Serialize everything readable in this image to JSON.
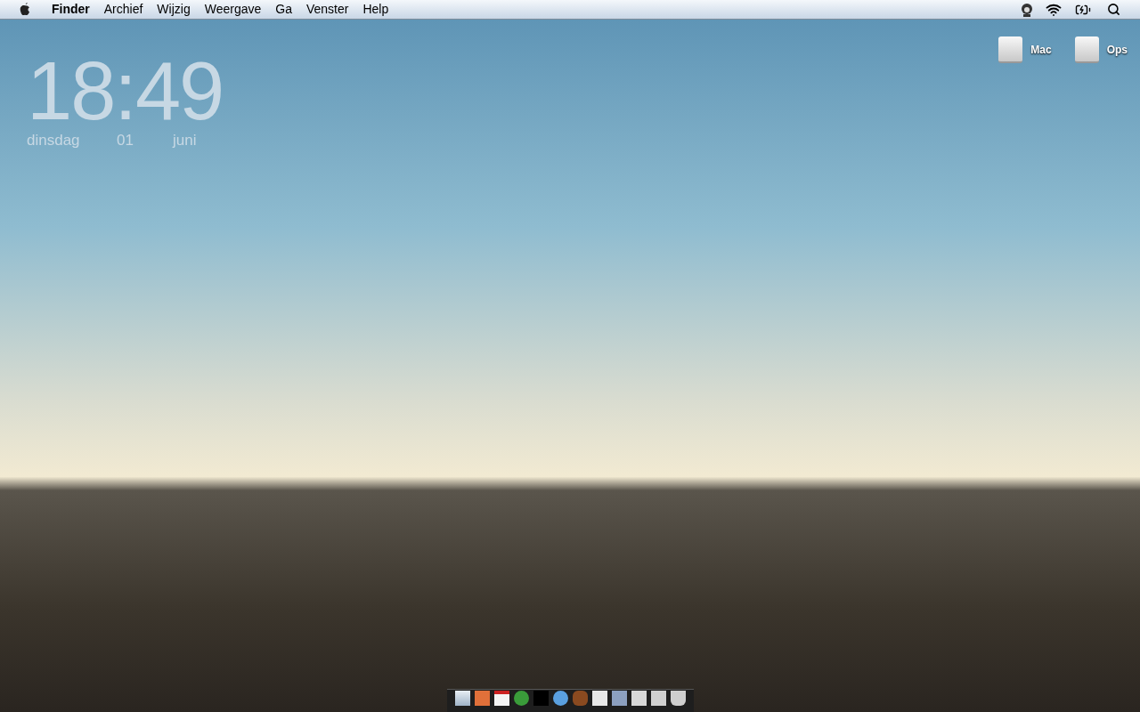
{
  "menu_bar": {
    "app_menu": "Finder",
    "menus": [
      "Archief",
      "Wijzig",
      "Weergave",
      "Ga",
      "Venster",
      "Help"
    ]
  },
  "clock_widget": {
    "time": "18:49",
    "weekday": "dinsdag",
    "day": "01",
    "month": "juni"
  },
  "desktop_icons": [
    {
      "label": "Mac"
    },
    {
      "label": "Ops"
    }
  ]
}
